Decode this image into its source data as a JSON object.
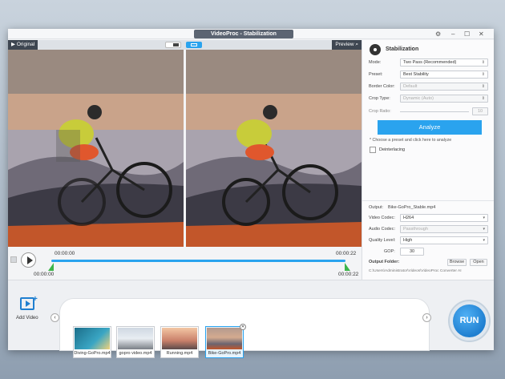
{
  "window": {
    "title": "VideoProc - Stabilization"
  },
  "preview": {
    "original_label": "Original",
    "preview_label": "Preview"
  },
  "timeline": {
    "time_start": "00:00:00",
    "time_end": "00:00:22",
    "trim_start": "00:00:00",
    "trim_end": "00:00:22"
  },
  "stabilization": {
    "heading": "Stabilization",
    "mode_label": "Mode:",
    "mode_value": "Two Pass (Recommended)",
    "preset_label": "Preset:",
    "preset_value": "Best Stability",
    "border_label": "Border Color:",
    "border_value": "Default",
    "crop_type_label": "Crop Type:",
    "crop_type_value": "Dynamic (Auto)",
    "crop_ratio_label": "Crop Ratio:",
    "crop_ratio_value": "10",
    "analyze_label": "Analyze",
    "hint": "* Choose a preset and click here to analyze",
    "deinterlacing_label": "Deinterlacing"
  },
  "output": {
    "output_label": "Output:",
    "output_file": "Bike-GoPro_Stable.mp4",
    "video_codec_label": "Video Codec:",
    "video_codec_value": "H264",
    "audio_codec_label": "Audio Codec:",
    "audio_codec_value": "Passthrough",
    "quality_label": "Quality Level:",
    "quality_value": "High",
    "gop_label": "GOP:",
    "gop_value": "30",
    "folder_label": "Output Folder:",
    "browse_label": "Browse",
    "open_label": "Open",
    "folder_path": "C:\\Users\\Administrator\\Videos\\VideoProc Converter AI"
  },
  "media": {
    "add_video_label": "Add Video",
    "items": [
      {
        "name": "Diving-GoPro.mp4"
      },
      {
        "name": "gopro video.mp4"
      },
      {
        "name": "Running.mp4"
      },
      {
        "name": "Bike-GoPro.mp4"
      }
    ],
    "run_label": "RUN"
  },
  "colors": {
    "accent": "#2aa3ee",
    "run": "#1f7fd0",
    "marker": "#3cb54a"
  }
}
